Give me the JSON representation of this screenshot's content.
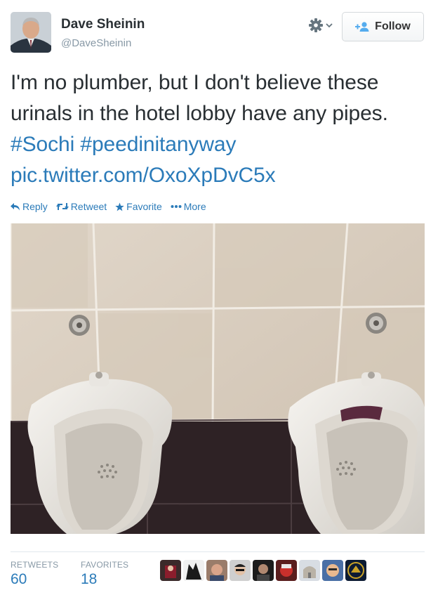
{
  "tweet": {
    "author_name": "Dave Sheinin",
    "author_handle": "@DaveSheinin",
    "follow_label": "Follow",
    "text_plain": "I'm no plumber, but I don't believe these urinals in the hotel lobby have any pipes.",
    "hashtag_1": "#Sochi",
    "hashtag_2": "#peedinitanyway",
    "pic_link": "pic.twitter.com/OxoXpDvC5x"
  },
  "actions": {
    "reply_label": "Reply",
    "retweet_label": "Retweet",
    "favorite_label": "Favorite",
    "more_label": "More"
  },
  "stats": {
    "retweets_label": "RETWEETS",
    "retweets_value": "60",
    "favorites_label": "FAVORITES",
    "favorites_value": "18"
  },
  "icons": {
    "settings": "gear-icon",
    "dropdown": "chevron-down-icon",
    "follow": "add-user-icon",
    "reply": "reply-icon",
    "retweet": "retweet-icon",
    "favorite": "star-icon",
    "more": "more-dots-icon"
  },
  "colors": {
    "link": "#2b7bb9",
    "text": "#292f33",
    "muted": "#8899a6"
  }
}
